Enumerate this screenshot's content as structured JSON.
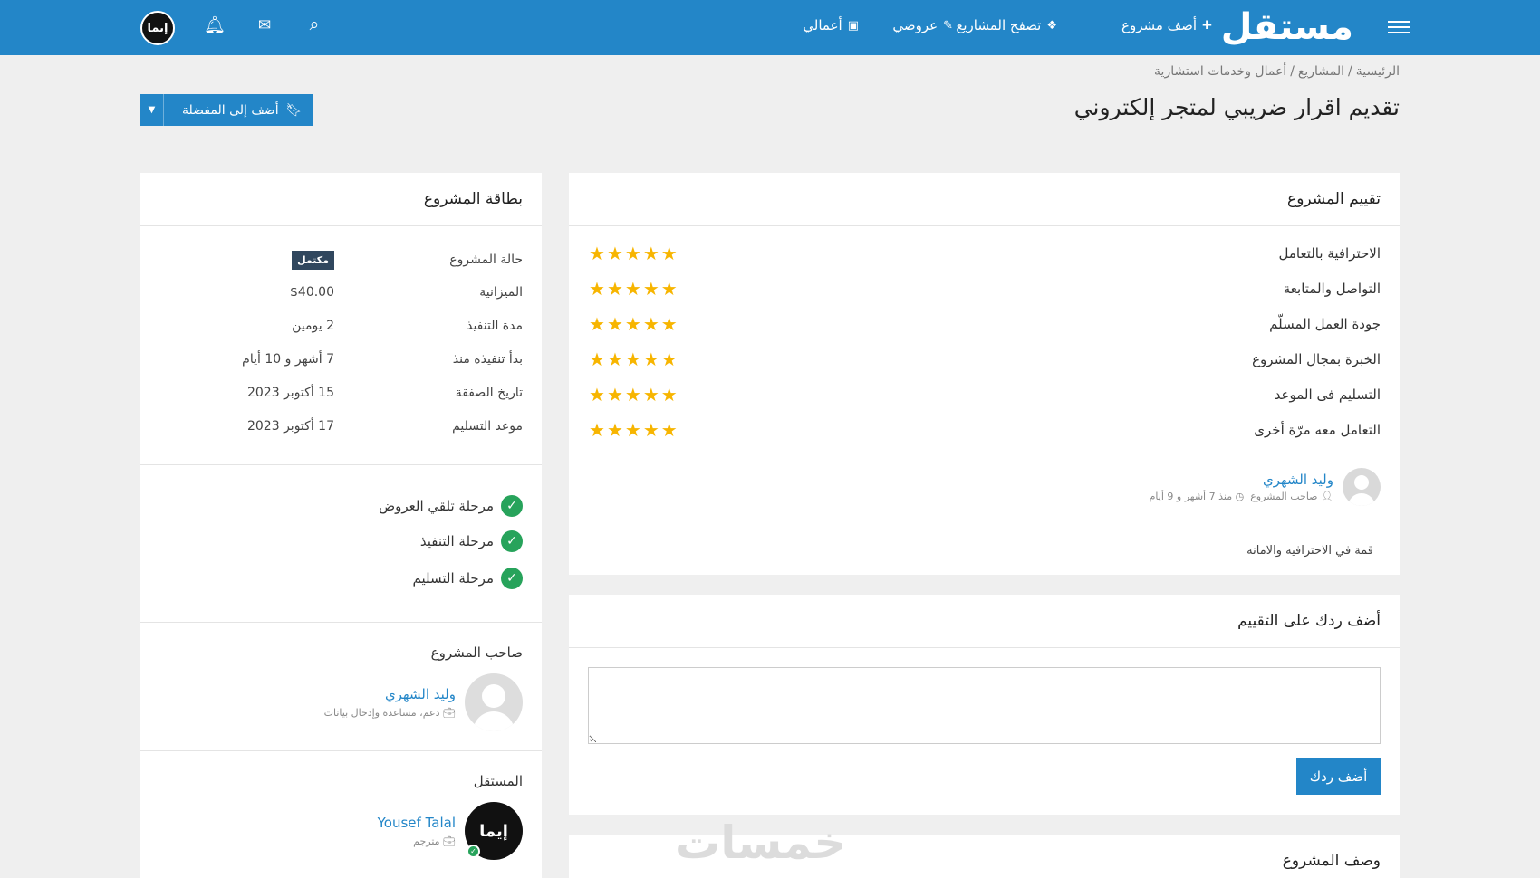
{
  "nav": {
    "logo": "مستقل",
    "items": [
      {
        "label": "أضف مشروع",
        "icon": "plus-icon",
        "glyph": "✚"
      },
      {
        "label": "تصفح المشاريع",
        "icon": "cubes-icon",
        "glyph": "❖"
      },
      {
        "label": "عروضي",
        "icon": "ticket-icon",
        "glyph": "✎"
      },
      {
        "label": "أعمالي",
        "icon": "briefcase-icon",
        "glyph": "▣"
      }
    ],
    "user_avatar_text": "إيما"
  },
  "breadcrumb": [
    "الرئيسية",
    "المشاريع",
    "أعمال وخدمات استشارية"
  ],
  "page_title": "تقديم اقرار ضريبي لمتجر إلكتروني",
  "favorite_button": "أضف إلى المفضلة",
  "rating_panel": {
    "title": "تقييم المشروع",
    "criteria": [
      {
        "label": "الاحترافية بالتعامل",
        "stars": 5
      },
      {
        "label": "التواصل والمتابعة",
        "stars": 5
      },
      {
        "label": "جودة العمل المسلّم",
        "stars": 5
      },
      {
        "label": "الخبرة بمجال المشروع",
        "stars": 5
      },
      {
        "label": "التسليم فى الموعد",
        "stars": 5
      },
      {
        "label": "التعامل معه مرّة أخرى",
        "stars": 5
      }
    ],
    "reviewer": {
      "name": "وليد الشهري",
      "role": "صاحب المشروع",
      "time": "منذ 7 أشهر و 9 أيام"
    },
    "review_text": "قمة في الاحترافيه والامانه"
  },
  "reply_panel": {
    "title": "أضف ردك على التقييم",
    "button": "أضف ردك"
  },
  "description_panel": {
    "title": "وصف المشروع"
  },
  "project_card": {
    "title": "بطاقة المشروع",
    "rows": [
      {
        "key": "حالة المشروع",
        "value": "مكتمل"
      },
      {
        "key": "الميزانية",
        "value": "$40.00"
      },
      {
        "key": "مدة التنفيذ",
        "value": "2 يومين"
      },
      {
        "key": "بدأ تنفيذه منذ",
        "value": "7 أشهر و 10 أيام"
      },
      {
        "key": "تاريخ الصفقة",
        "value": "15 أكتوبر 2023"
      },
      {
        "key": "موعد التسليم",
        "value": "17 أكتوبر 2023"
      }
    ],
    "stages": [
      "مرحلة تلقي العروض",
      "مرحلة التنفيذ",
      "مرحلة التسليم"
    ],
    "owner_label": "صاحب المشروع",
    "owner": {
      "name": "وليد الشهري",
      "meta": "دعم، مساعدة وإدخال بيانات"
    },
    "freelancer_label": "المستقل",
    "freelancer": {
      "name": "Yousef Talal",
      "meta": "مترجم",
      "avatar_text": "إيما"
    }
  },
  "watermark": "خمسات"
}
